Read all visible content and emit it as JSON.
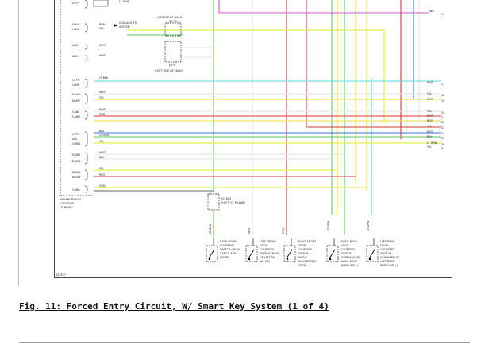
{
  "figure": {
    "caption": "Fig. 11: Forced Entry Circuit, W/ Smart Key System (1 of 4)",
    "figure_code": "332827"
  },
  "palette": {
    "green": "#5ec95e",
    "yellow": "#e6e629",
    "cyan": "#5fd3e3",
    "red": "#d9363b",
    "magenta": "#d64fd6",
    "blue": "#3d6fe0",
    "white": "#e2e2e2",
    "frame": "#444444"
  },
  "module": {
    "pins_top": [
      "DETY"
    ],
    "pins_group1": [
      "HRLY",
      "LAMP",
      "AM2",
      "AM1"
    ],
    "pins_group2": [
      "LCTY",
      "LAMP",
      "DASW",
      "DAMP",
      "CANL",
      "CANH",
      "KSTO",
      "SLS",
      "LSWD",
      "DSW2",
      "DSW3",
      "BDSW",
      "RDSW",
      "GSWL"
    ],
    "footer_lines": [
      "MAIN BODY ECU",
      "(LEFT SIDE",
      "OF DASH)"
    ]
  },
  "wire_labels": {
    "top": "LT GRN",
    "headlight_system": [
      "HEADLIGHTS",
      "SYSTEM"
    ],
    "center_of_dash": "(CENTER OF DASH)",
    "left_side_of_dash": "(LEFT SIDE OF DASH)",
    "junction_j53": "J/B 53",
    "junction_j58": "J/B 8",
    "connector": "J/B 9"
  },
  "right_pins": [
    {
      "label": "WHT",
      "num": "17"
    },
    {
      "label": "YEL",
      "num": "18"
    },
    {
      "label": "WHT",
      "num": "19"
    },
    {
      "label": "YEL",
      "num": "20"
    },
    {
      "label": "WHT",
      "num": "21"
    },
    {
      "label": "RED",
      "num": "22"
    },
    {
      "label": "YEL",
      "num": "23"
    },
    {
      "label": "RED",
      "num": "24"
    },
    {
      "label": "BLK",
      "num": "25"
    },
    {
      "label": "LT GRN",
      "num": "26"
    },
    {
      "label": "YEL",
      "num": "27"
    }
  ],
  "switches": [
    {
      "label": "BACK DOOR COURTESY SWITCH (REAR CARGO AREA DOOR)",
      "wire": "LT GRN"
    },
    {
      "label": "LEFT FRONT DOOR COURTESY SWITCH (BASE OF LEFT \"B\" PILLAR)",
      "wire": "WHT"
    },
    {
      "label": "RIGHT FRONT DOOR COURTESY SWITCH (RIGHT PASSENGER'S DOOR)",
      "wire": "RED"
    },
    {
      "label": "RIGHT REAR DOOR COURTESY SWITCH (FORWARD OF RIGHT REAR WHEELWELL)",
      "wire": "LT GRN"
    },
    {
      "label": "LEFT REAR DOOR COURTESY SWITCH (FORWARD OF LEFT REAR WHEELWELL)",
      "wire": "LT GRN"
    }
  ],
  "connector_j68": {
    "label": "J/C K10",
    "location": "(LEFT \"C\" PILLAR)"
  }
}
